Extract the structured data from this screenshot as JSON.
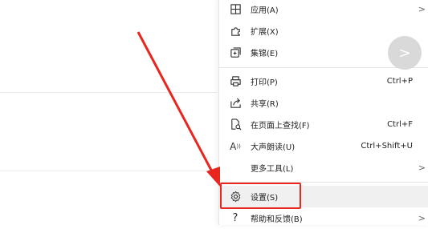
{
  "menu": {
    "items": [
      {
        "label": "应用(A)",
        "icon": "apps-icon",
        "has_submenu": true
      },
      {
        "label": "扩展(X)",
        "icon": "puzzle-extension-icon"
      },
      {
        "label": "集锦(E)",
        "icon": "collections-icon"
      },
      {
        "label": "打印(P)",
        "icon": "printer-icon",
        "shortcut": "Ctrl+P"
      },
      {
        "label": "共享(R)",
        "icon": "share-icon"
      },
      {
        "label": "在页面上查找(F)",
        "icon": "find-on-page-icon",
        "shortcut": "Ctrl+F"
      },
      {
        "label": "大声朗读(U)",
        "icon": "read-aloud-icon",
        "shortcut": "Ctrl+Shift+U"
      },
      {
        "label": "更多工具(L)",
        "icon": "",
        "has_submenu": true
      },
      {
        "label": "设置(S)",
        "icon": "gear-icon",
        "highlighted": true
      },
      {
        "label": "帮助和反馈(B)",
        "icon": "question-icon",
        "has_submenu": true
      }
    ]
  },
  "fab": {
    "icon": "chevron-right-icon"
  },
  "annotation": {
    "arrow_color": "#e8261f",
    "highlight_color": "#e8261f"
  }
}
